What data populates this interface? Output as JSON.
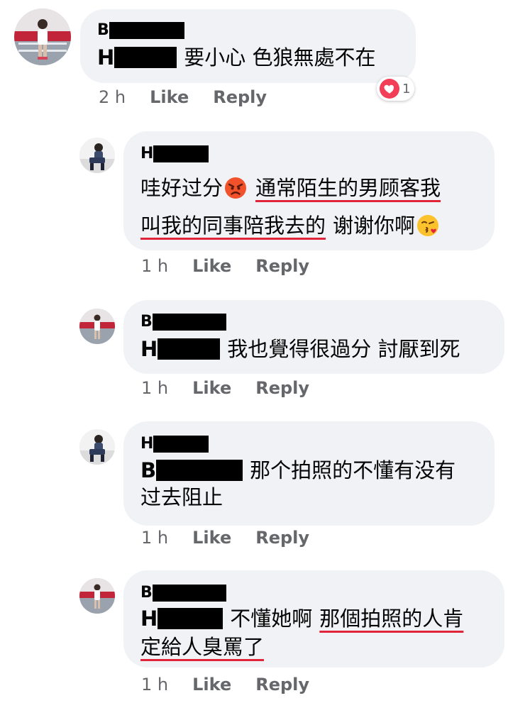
{
  "comments": [
    {
      "author_initial": "B",
      "text_initial": "H",
      "text": "要小心 色狼無處不在",
      "time": "2 h",
      "like": "Like",
      "reply": "Reply",
      "reaction": {
        "icon": "heart-icon",
        "count": "1",
        "color": "#f33e58"
      }
    },
    {
      "author_initial": "H",
      "line1_a": "哇好过分",
      "line1_b": "通常陌生的男顾客我",
      "line2_a": "叫我的同事陪我去的",
      "line2_b": "谢谢你啊",
      "emoji_1": "angry-face-emoji",
      "emoji_2": "face-blowing-kiss-emoji",
      "time": "1 h",
      "like": "Like",
      "reply": "Reply"
    },
    {
      "author_initial": "B",
      "text_initial": "H",
      "text": "我也覺得很過分 討厭到死",
      "time": "1 h",
      "like": "Like",
      "reply": "Reply"
    },
    {
      "author_initial": "H",
      "text_initial": "B",
      "line1": "那个拍照的不懂有没有",
      "line2": "过去阻止",
      "time": "1 h",
      "like": "Like",
      "reply": "Reply"
    },
    {
      "author_initial": "B",
      "text_initial": "H",
      "line1_a": "不懂她啊",
      "line1_b": "那個拍照的人肯",
      "line2": "定給人臭罵了",
      "time": "1 h",
      "like": "Like",
      "reply": "Reply"
    }
  ],
  "colors": {
    "bubble": "#f0f2f5",
    "meta_text": "#65676b",
    "underline": "#e0243a",
    "redaction": "#000000"
  }
}
